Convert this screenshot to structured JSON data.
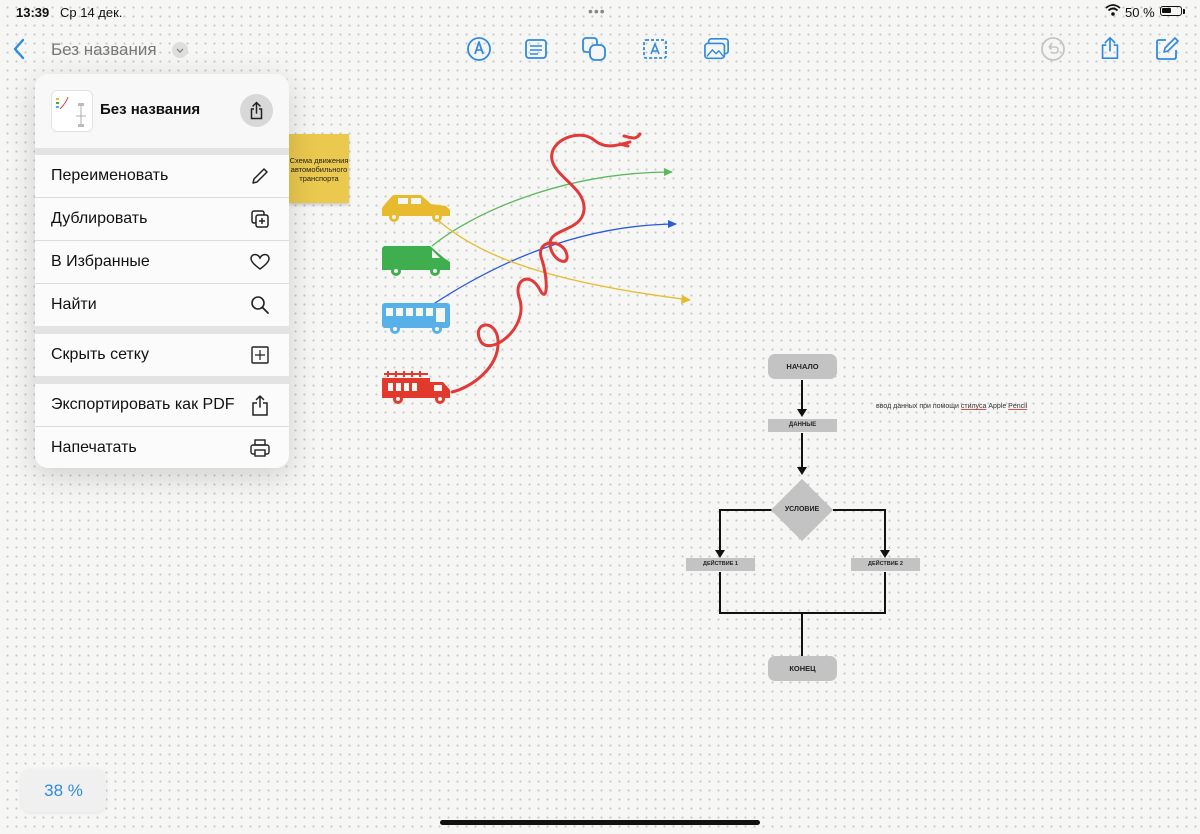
{
  "status_bar": {
    "time": "13:39",
    "date": "Ср 14 дек.",
    "battery": "50 %",
    "battery_level": 0.5
  },
  "toolbar": {
    "title": "Без названия",
    "icons": [
      "back-icon",
      "pen-icon",
      "text-block-icon",
      "shapes-icon",
      "text-box-icon",
      "photo-icon",
      "undo-icon",
      "share-icon",
      "compose-icon"
    ]
  },
  "menu": {
    "doc_title": "Без названия",
    "items": [
      {
        "label": "Переименовать",
        "icon": "pencil-icon"
      },
      {
        "label": "Дублировать",
        "icon": "duplicate-icon"
      },
      {
        "label": "В Избранные",
        "icon": "heart-icon"
      },
      {
        "label": "Найти",
        "icon": "magnifier-icon"
      },
      {
        "label": "Скрыть сетку",
        "icon": "grid-icon"
      },
      {
        "label": "Экспортировать как PDF",
        "icon": "export-icon"
      },
      {
        "label": "Напечатать",
        "icon": "printer-icon"
      }
    ]
  },
  "canvas": {
    "sticky_note": "Схема движения автомобильного транспорта",
    "vehicles": [
      "car-icon",
      "van-icon",
      "bus-icon",
      "fire-truck-icon"
    ],
    "colors": {
      "car": "#e8bb2e",
      "van": "#3fae4e",
      "bus": "#58b0e8",
      "fire_truck": "#e2392c",
      "scribble": "#e03a3a"
    },
    "flowchart": {
      "start": "НАЧАЛО",
      "data": "ДАННЫЕ",
      "condition": "УСЛОВИЕ",
      "action1": "ДЕЙСТВИЕ 1",
      "action2": "ДЕЙСТВИЕ 2",
      "end": "КОНЕЦ"
    },
    "note": {
      "before": "ввод данных при помощи ",
      "underlined1": "стилуса",
      "middle": " Apple ",
      "underlined2": "Pencil"
    }
  },
  "zoom": "38 %"
}
